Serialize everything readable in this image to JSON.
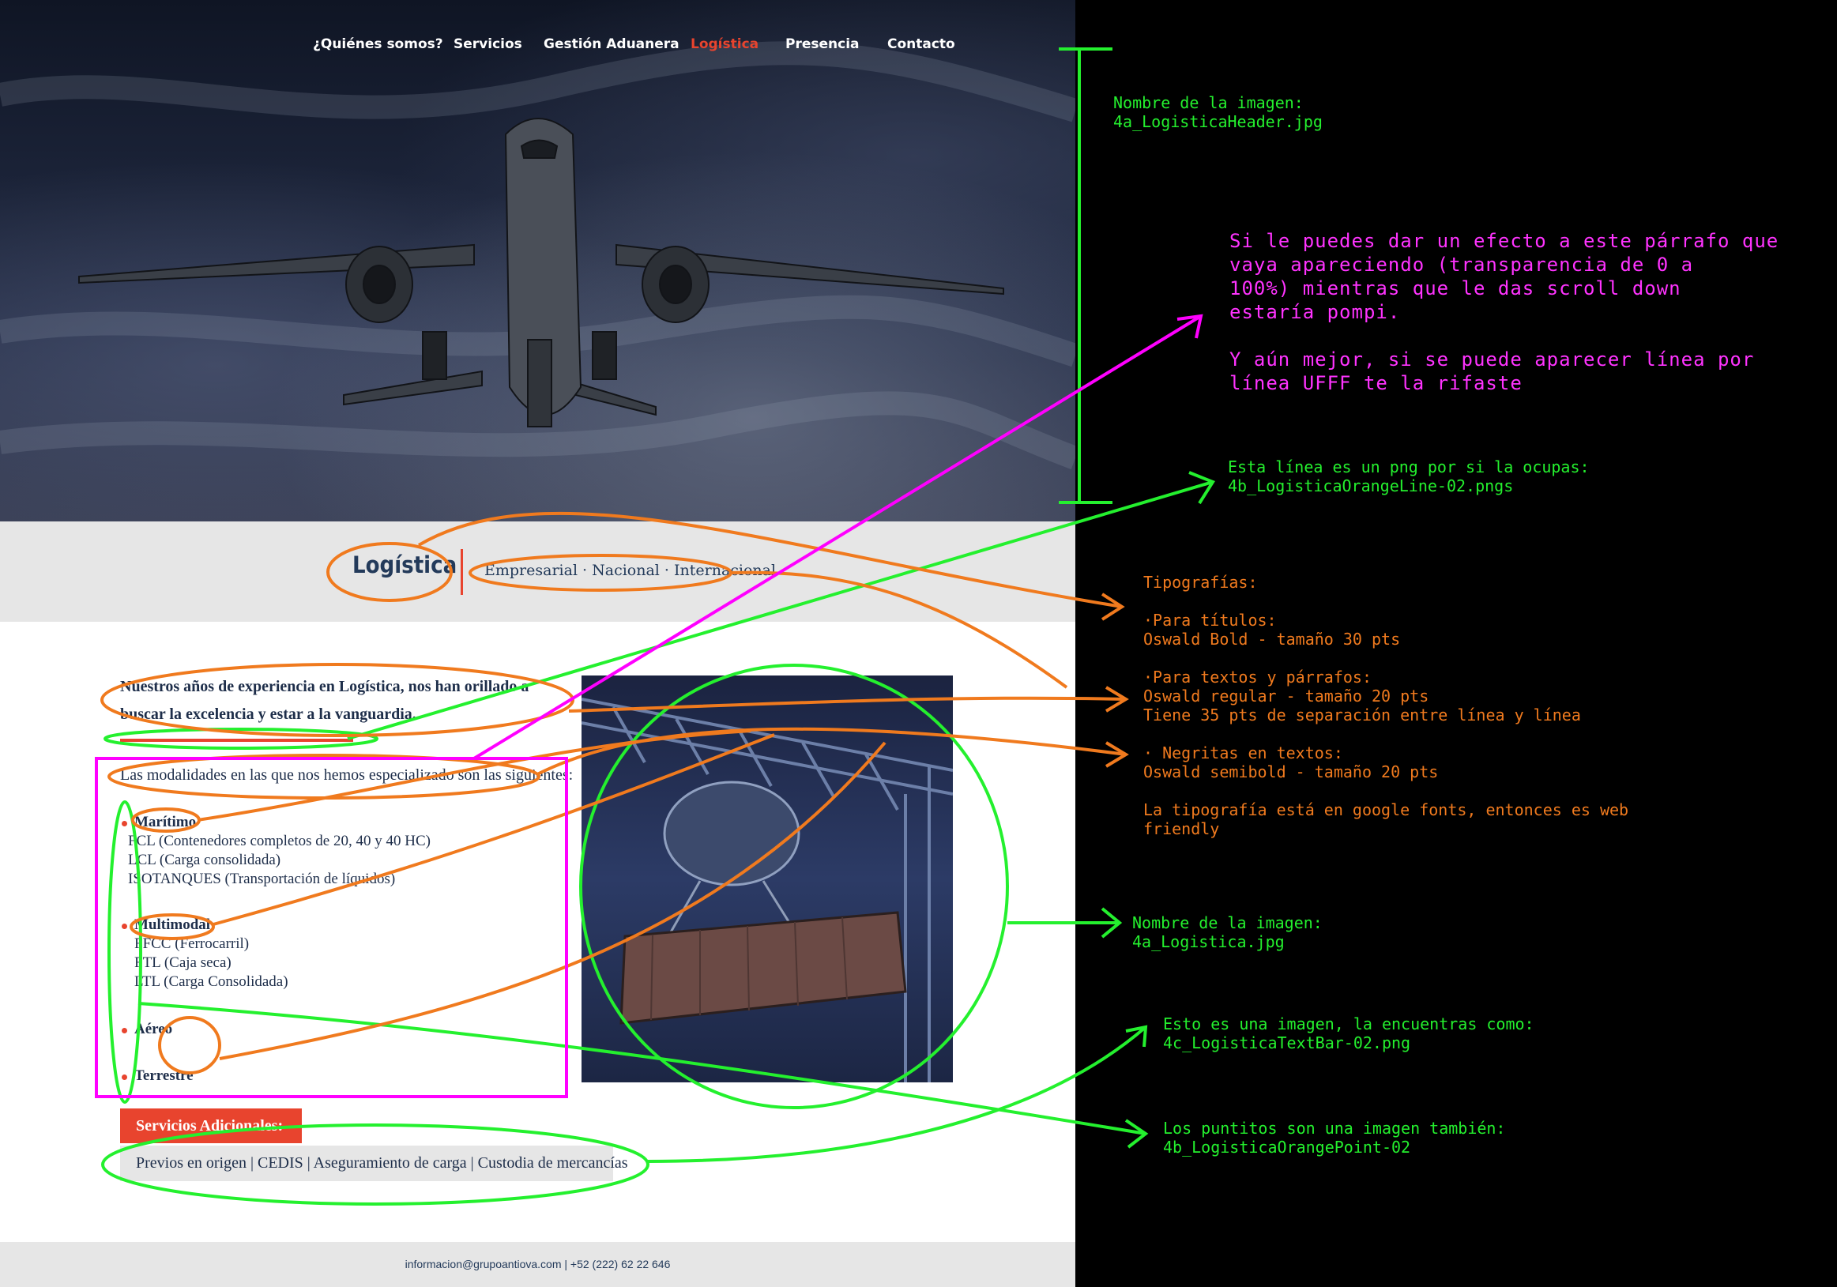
{
  "nav": {
    "items": [
      "¿Quiénes somos?",
      "Servicios",
      "Gestión Aduanera",
      "Logística",
      "Presencia",
      "Contacto"
    ],
    "active": "Logística"
  },
  "band": {
    "title": "Logística",
    "subtitle": "Empresarial · Nacional · Internacional"
  },
  "content": {
    "intro": "Nuestros años de experiencia en Logística, nos han orillado a buscar la excelencia y estar a la vanguardia.",
    "modalities_intro": "Las modalidades en las que nos hemos especializado son las siguientes:",
    "modalities": [
      {
        "name": "Marítimo",
        "details": [
          "FCL (Contenedores completos de 20, 40 y 40 HC)",
          "LCL (Carga consolidada)",
          "ISOTANQUES (Transportación de líquidos)"
        ]
      },
      {
        "name": "Multimodal",
        "details": [
          "FFCC (Ferrocarril)",
          "FTL (Caja seca)",
          "LTL (Carga Consolidada)"
        ]
      },
      {
        "name": "Aéreo",
        "details": []
      },
      {
        "name": "Terrestre",
        "details": []
      }
    ],
    "services_label": "Servicios Adicionales:",
    "services_list": "Previos en origen  |  CEDIS   |  Aseguramiento de carga  |  Custodia de mercancías"
  },
  "footer": {
    "contact": "informacion@grupoantiova.com | +52 (222) 62 22 646"
  },
  "annotations": {
    "header_image": "Nombre de la imagen:\n4a_LogisticaHeader.jpg",
    "fade_effect": "Si le puedes dar un efecto a este párrafo que\nvaya apareciendo (transparencia de 0 a\n100%) mientras que le das scroll down\nestaría pompi.\n\nY aún mejor, si se puede aparecer línea por\nlínea UFFF te la rifaste",
    "orange_line": "Esta línea es un png por si la ocupas:\n4b_LogisticaOrangeLine-02.pngs",
    "typography": "Tipografías:\n\n·Para títulos:\nOswald Bold - tamaño 30 pts\n\n·Para textos y párrafos:\nOswald regular - tamaño 20 pts\nTiene 35 pts de separación entre línea y línea\n\n· Negritas en textos:\nOswald semibold - tamaño 20 pts\n\nLa tipografía está en google fonts, entonces es web\nfriendly",
    "photo_image": "Nombre de la imagen:\n4a_Logistica.jpg",
    "text_bar": "Esto es una imagen, la encuentras como:\n4c_LogisticaTextBar-02.png",
    "points": "Los puntitos son una imagen también:\n4b_LogisticaOrangePoint-02"
  },
  "colors": {
    "accent": "#e8442e",
    "navy": "#233a5a",
    "band": "#e6e6e6",
    "annotation_green": "#24f02e",
    "annotation_orange": "#f07a1e",
    "annotation_magenta": "#ff33ff"
  }
}
